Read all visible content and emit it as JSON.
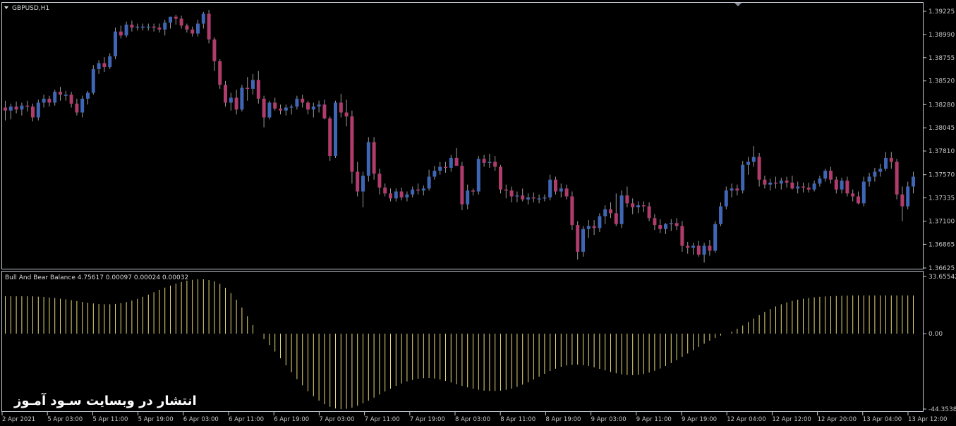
{
  "colors": {
    "background": "#000000",
    "frame": "#c4c8d0",
    "bull_candle": "#3f66b4",
    "bear_candle": "#b03c6c",
    "wick": "#9a9a9a",
    "histogram": "#e8d878",
    "axis_text": "#c8c8c8"
  },
  "main_pane": {
    "symbol_label": "GBPUSD,H1",
    "price_labels": [
      "1.39225",
      "1.38990",
      "1.38755",
      "1.38520",
      "1.38280",
      "1.38045",
      "1.37810",
      "1.37570",
      "1.37335",
      "1.37100",
      "1.36865",
      "1.36625"
    ]
  },
  "sub_pane": {
    "title": "Bull And Bear Balance 4.75617 0.00097 0.00024 0.00032",
    "value_labels": [
      "33.65542",
      "0.00",
      "-44.35384"
    ]
  },
  "time_labels": [
    "2 Apr 2021",
    "5 Apr 03:00",
    "5 Apr 11:00",
    "5 Apr 19:00",
    "6 Apr 03:00",
    "6 Apr 11:00",
    "6 Apr 19:00",
    "7 Apr 03:00",
    "7 Apr 11:00",
    "7 Apr 19:00",
    "8 Apr 03:00",
    "8 Apr 11:00",
    "8 Apr 19:00",
    "9 Apr 03:00",
    "9 Apr 11:00",
    "9 Apr 19:00",
    "12 Apr 04:00",
    "12 Apr 12:00",
    "12 Apr 20:00",
    "13 Apr 04:00",
    "13 Apr 12:00"
  ],
  "watermark": "انتشار در وبسایت سـود آمـوز",
  "chart_data": [
    {
      "type": "candlestick",
      "title": "GBPUSD,H1",
      "ylim": [
        1.36625,
        1.39225
      ],
      "ohlc": [
        [
          1.3825,
          1.3832,
          1.3812,
          1.3822
        ],
        [
          1.3822,
          1.3829,
          1.3813,
          1.3826
        ],
        [
          1.3826,
          1.3831,
          1.3819,
          1.3823
        ],
        [
          1.3823,
          1.383,
          1.3817,
          1.3827
        ],
        [
          1.3827,
          1.3832,
          1.3821,
          1.3826
        ],
        [
          1.3826,
          1.3829,
          1.3811,
          1.3815
        ],
        [
          1.3815,
          1.3833,
          1.3812,
          1.383
        ],
        [
          1.383,
          1.3838,
          1.3825,
          1.3834
        ],
        [
          1.3834,
          1.3837,
          1.3826,
          1.383
        ],
        [
          1.383,
          1.3843,
          1.3827,
          1.3841
        ],
        [
          1.3841,
          1.3846,
          1.3832,
          1.3838
        ],
        [
          1.3838,
          1.3842,
          1.3832,
          1.3838
        ],
        [
          1.3838,
          1.3841,
          1.3825,
          1.3829
        ],
        [
          1.3829,
          1.3834,
          1.3817,
          1.382
        ],
        [
          1.382,
          1.3837,
          1.3815,
          1.3834
        ],
        [
          1.3834,
          1.3842,
          1.3828,
          1.384
        ],
        [
          1.384,
          1.3868,
          1.3838,
          1.3864
        ],
        [
          1.3864,
          1.3873,
          1.3859,
          1.387
        ],
        [
          1.387,
          1.3876,
          1.3861,
          1.3866
        ],
        [
          1.3866,
          1.388,
          1.3864,
          1.3877
        ],
        [
          1.3877,
          1.3906,
          1.3874,
          1.3902
        ],
        [
          1.3902,
          1.3908,
          1.3895,
          1.3898
        ],
        [
          1.3898,
          1.3912,
          1.3896,
          1.3909
        ],
        [
          1.3909,
          1.3913,
          1.3902,
          1.3906
        ],
        [
          1.3906,
          1.391,
          1.3903,
          1.3907
        ],
        [
          1.3907,
          1.391,
          1.3903,
          1.3907
        ],
        [
          1.3907,
          1.391,
          1.3903,
          1.3907
        ],
        [
          1.3907,
          1.391,
          1.3902,
          1.3906
        ],
        [
          1.3906,
          1.391,
          1.3901,
          1.3904
        ],
        [
          1.3904,
          1.3914,
          1.3898,
          1.3911
        ],
        [
          1.3911,
          1.3917,
          1.3905,
          1.3917
        ],
        [
          1.3917,
          1.3919,
          1.3909,
          1.3915
        ],
        [
          1.3915,
          1.3918,
          1.3905,
          1.3908
        ],
        [
          1.3908,
          1.391,
          1.3901,
          1.3904
        ],
        [
          1.3904,
          1.3907,
          1.3897,
          1.39
        ],
        [
          1.39,
          1.3914,
          1.3897,
          1.391
        ],
        [
          1.391,
          1.3922,
          1.3905,
          1.392
        ],
        [
          1.392,
          1.3924,
          1.389,
          1.3894
        ],
        [
          1.3894,
          1.3896,
          1.3862,
          1.3872
        ],
        [
          1.3872,
          1.3874,
          1.3844,
          1.3848
        ],
        [
          1.3848,
          1.3852,
          1.3826,
          1.383
        ],
        [
          1.383,
          1.384,
          1.3822,
          1.3835
        ],
        [
          1.3835,
          1.3843,
          1.3818,
          1.3823
        ],
        [
          1.3823,
          1.3848,
          1.3821,
          1.3845
        ],
        [
          1.3845,
          1.3856,
          1.3832,
          1.3844
        ],
        [
          1.3844,
          1.3859,
          1.3838,
          1.3853
        ],
        [
          1.3853,
          1.3862,
          1.3829,
          1.3834
        ],
        [
          1.3834,
          1.3837,
          1.3805,
          1.3815
        ],
        [
          1.3815,
          1.3832,
          1.3813,
          1.383
        ],
        [
          1.383,
          1.3835,
          1.3822,
          1.3824
        ],
        [
          1.3824,
          1.3828,
          1.3818,
          1.3822
        ],
        [
          1.3822,
          1.3828,
          1.3817,
          1.3825
        ],
        [
          1.3825,
          1.3828,
          1.3818,
          1.3826
        ],
        [
          1.3826,
          1.3837,
          1.3823,
          1.3834
        ],
        [
          1.3834,
          1.3838,
          1.3825,
          1.383
        ],
        [
          1.383,
          1.3832,
          1.3818,
          1.3823
        ],
        [
          1.3823,
          1.383,
          1.3815,
          1.3826
        ],
        [
          1.3826,
          1.3832,
          1.382,
          1.3828
        ],
        [
          1.3828,
          1.3833,
          1.3813,
          1.3814
        ],
        [
          1.3814,
          1.3816,
          1.3771,
          1.3776
        ],
        [
          1.3776,
          1.3832,
          1.3774,
          1.383
        ],
        [
          1.383,
          1.3839,
          1.3815,
          1.382
        ],
        [
          1.382,
          1.3833,
          1.3806,
          1.3816
        ],
        [
          1.3816,
          1.3822,
          1.3748,
          1.376
        ],
        [
          1.376,
          1.377,
          1.3735,
          1.374
        ],
        [
          1.374,
          1.376,
          1.3724,
          1.3756
        ],
        [
          1.3756,
          1.3795,
          1.375,
          1.379
        ],
        [
          1.379,
          1.3795,
          1.3752,
          1.3758
        ],
        [
          1.3758,
          1.3763,
          1.3737,
          1.3744
        ],
        [
          1.3744,
          1.3748,
          1.3735,
          1.3738
        ],
        [
          1.3738,
          1.3743,
          1.373,
          1.3733
        ],
        [
          1.3733,
          1.3743,
          1.373,
          1.374
        ],
        [
          1.374,
          1.3744,
          1.3731,
          1.3734
        ],
        [
          1.3734,
          1.374,
          1.373,
          1.3737
        ],
        [
          1.3737,
          1.3745,
          1.3734,
          1.3742
        ],
        [
          1.3742,
          1.3748,
          1.3737,
          1.3741
        ],
        [
          1.3741,
          1.3746,
          1.3736,
          1.3743
        ],
        [
          1.3743,
          1.3762,
          1.3741,
          1.3755
        ],
        [
          1.3755,
          1.3766,
          1.3752,
          1.3761
        ],
        [
          1.3761,
          1.377,
          1.3757,
          1.3765
        ],
        [
          1.3765,
          1.377,
          1.3759,
          1.3764
        ],
        [
          1.3764,
          1.3777,
          1.376,
          1.3774
        ],
        [
          1.3774,
          1.3784,
          1.3768,
          1.3766
        ],
        [
          1.3766,
          1.377,
          1.3721,
          1.3727
        ],
        [
          1.3727,
          1.3747,
          1.3722,
          1.3741
        ],
        [
          1.3741,
          1.3743,
          1.3736,
          1.374
        ],
        [
          1.374,
          1.3776,
          1.3737,
          1.3773
        ],
        [
          1.3773,
          1.3777,
          1.3765,
          1.3769
        ],
        [
          1.3769,
          1.3778,
          1.3764,
          1.377
        ],
        [
          1.377,
          1.3776,
          1.3761,
          1.3765
        ],
        [
          1.3765,
          1.3767,
          1.3738,
          1.3742
        ],
        [
          1.3742,
          1.3747,
          1.3733,
          1.3741
        ],
        [
          1.3741,
          1.3745,
          1.3729,
          1.3735
        ],
        [
          1.3735,
          1.374,
          1.3729,
          1.3736
        ],
        [
          1.3736,
          1.3743,
          1.373,
          1.3732
        ],
        [
          1.3732,
          1.3738,
          1.3727,
          1.3734
        ],
        [
          1.3734,
          1.3739,
          1.3729,
          1.3733
        ],
        [
          1.3733,
          1.3737,
          1.3728,
          1.3733
        ],
        [
          1.3733,
          1.3737,
          1.373,
          1.3734
        ],
        [
          1.3734,
          1.3757,
          1.3731,
          1.3752
        ],
        [
          1.3752,
          1.3755,
          1.3737,
          1.374
        ],
        [
          1.374,
          1.3748,
          1.3734,
          1.3743
        ],
        [
          1.3743,
          1.3747,
          1.3732,
          1.3735
        ],
        [
          1.3735,
          1.374,
          1.3701,
          1.3706
        ],
        [
          1.3706,
          1.371,
          1.3671,
          1.3679
        ],
        [
          1.3679,
          1.3705,
          1.3674,
          1.3702
        ],
        [
          1.3702,
          1.3711,
          1.3693,
          1.3705
        ],
        [
          1.3705,
          1.3711,
          1.3696,
          1.3703
        ],
        [
          1.3703,
          1.3718,
          1.3699,
          1.3715
        ],
        [
          1.3715,
          1.3726,
          1.3707,
          1.3722
        ],
        [
          1.3722,
          1.3729,
          1.3713,
          1.3718
        ],
        [
          1.3718,
          1.3738,
          1.3705,
          1.3707
        ],
        [
          1.3707,
          1.3741,
          1.3703,
          1.3736
        ],
        [
          1.3736,
          1.3745,
          1.3724,
          1.3728
        ],
        [
          1.3728,
          1.3733,
          1.3717,
          1.3724
        ],
        [
          1.3724,
          1.373,
          1.3718,
          1.3726
        ],
        [
          1.3726,
          1.373,
          1.3719,
          1.3725
        ],
        [
          1.3725,
          1.3729,
          1.371,
          1.3713
        ],
        [
          1.3713,
          1.3717,
          1.3701,
          1.3706
        ],
        [
          1.3706,
          1.3712,
          1.3698,
          1.3702
        ],
        [
          1.3702,
          1.3708,
          1.3697,
          1.3707
        ],
        [
          1.3707,
          1.3712,
          1.37,
          1.3708
        ],
        [
          1.3708,
          1.3713,
          1.3701,
          1.3705
        ],
        [
          1.3705,
          1.371,
          1.3679,
          1.3685
        ],
        [
          1.3685,
          1.3689,
          1.3677,
          1.3683
        ],
        [
          1.3683,
          1.3688,
          1.3676,
          1.3685
        ],
        [
          1.3685,
          1.369,
          1.3674,
          1.3676
        ],
        [
          1.3676,
          1.3688,
          1.3668,
          1.3685
        ],
        [
          1.3685,
          1.3691,
          1.3675,
          1.368
        ],
        [
          1.368,
          1.371,
          1.3678,
          1.3707
        ],
        [
          1.3707,
          1.3729,
          1.3705,
          1.3725
        ],
        [
          1.3725,
          1.3745,
          1.3722,
          1.3741
        ],
        [
          1.3741,
          1.3748,
          1.3734,
          1.3743
        ],
        [
          1.3743,
          1.3747,
          1.3736,
          1.3741
        ],
        [
          1.3741,
          1.3771,
          1.3738,
          1.3767
        ],
        [
          1.3767,
          1.3775,
          1.3757,
          1.377
        ],
        [
          1.377,
          1.3786,
          1.3765,
          1.3775
        ],
        [
          1.3775,
          1.3779,
          1.3745,
          1.3752
        ],
        [
          1.3752,
          1.3756,
          1.3743,
          1.3747
        ],
        [
          1.3747,
          1.3753,
          1.3741,
          1.3749
        ],
        [
          1.3749,
          1.3755,
          1.3743,
          1.3748
        ],
        [
          1.3748,
          1.3754,
          1.3742,
          1.3751
        ],
        [
          1.3751,
          1.3755,
          1.3744,
          1.3749
        ],
        [
          1.3749,
          1.3756,
          1.3742,
          1.3743
        ],
        [
          1.3743,
          1.375,
          1.3738,
          1.3745
        ],
        [
          1.3745,
          1.3749,
          1.3739,
          1.3744
        ],
        [
          1.3744,
          1.3749,
          1.3739,
          1.3742
        ],
        [
          1.3742,
          1.3751,
          1.374,
          1.3748
        ],
        [
          1.3748,
          1.3756,
          1.3745,
          1.3753
        ],
        [
          1.3753,
          1.3763,
          1.375,
          1.3761
        ],
        [
          1.3761,
          1.3765,
          1.3748,
          1.3752
        ],
        [
          1.3752,
          1.3755,
          1.3738,
          1.3742
        ],
        [
          1.3742,
          1.3754,
          1.3738,
          1.3751
        ],
        [
          1.3751,
          1.3755,
          1.3735,
          1.3738
        ],
        [
          1.3738,
          1.3742,
          1.373,
          1.3735
        ],
        [
          1.3735,
          1.374,
          1.3727,
          1.3728
        ],
        [
          1.3728,
          1.3755,
          1.3725,
          1.375
        ],
        [
          1.375,
          1.3759,
          1.3745,
          1.3755
        ],
        [
          1.3755,
          1.3764,
          1.375,
          1.376
        ],
        [
          1.376,
          1.3768,
          1.3755,
          1.3763
        ],
        [
          1.3763,
          1.378,
          1.3761,
          1.3774
        ],
        [
          1.3774,
          1.378,
          1.3763,
          1.377
        ],
        [
          1.377,
          1.3773,
          1.3732,
          1.3737
        ],
        [
          1.3737,
          1.3745,
          1.371,
          1.3725
        ],
        [
          1.3725,
          1.375,
          1.3722,
          1.3745
        ],
        [
          1.3745,
          1.376,
          1.3738,
          1.3755
        ]
      ]
    },
    {
      "type": "bar",
      "title": "Bull And Bear Balance 4.75617 0.00097 0.00024 0.00032",
      "ylim": [
        -44.35384,
        33.65542
      ],
      "values": [
        22.0,
        22.0,
        22.0,
        22.0,
        22.0,
        22.0,
        21.8,
        21.6,
        21.3,
        21.0,
        20.6,
        20.2,
        19.7,
        19.2,
        18.7,
        18.2,
        17.8,
        17.5,
        17.3,
        17.3,
        17.5,
        18.0,
        18.6,
        19.5,
        20.5,
        21.7,
        23.0,
        24.4,
        25.8,
        27.1,
        28.3,
        29.4,
        30.4,
        31.2,
        31.7,
        32.0,
        32.0,
        31.6,
        30.8,
        29.3,
        27.0,
        23.9,
        20.0,
        15.4,
        10.3,
        5.0,
        0.0,
        -3.2,
        -6.7,
        -10.5,
        -14.5,
        -18.6,
        -22.7,
        -26.7,
        -30.4,
        -33.8,
        -36.8,
        -39.4,
        -41.5,
        -43.0,
        -44.0,
        -44.4,
        -44.2,
        -43.5,
        -42.4,
        -41.0,
        -39.4,
        -37.6,
        -35.8,
        -34.0,
        -32.3,
        -30.7,
        -29.3,
        -28.1,
        -27.2,
        -26.5,
        -26.2,
        -26.1,
        -26.4,
        -27.0,
        -27.8,
        -28.7,
        -29.7,
        -30.7,
        -31.6,
        -32.4,
        -33.0,
        -33.5,
        -33.7,
        -33.7,
        -33.5,
        -33.0,
        -32.3,
        -31.3,
        -30.0,
        -28.6,
        -27.0,
        -25.3,
        -23.6,
        -22.0,
        -20.6,
        -19.5,
        -18.7,
        -18.3,
        -18.2,
        -18.5,
        -19.0,
        -19.8,
        -20.7,
        -21.6,
        -22.5,
        -23.3,
        -23.9,
        -24.3,
        -24.4,
        -24.2,
        -23.7,
        -22.9,
        -21.8,
        -20.5,
        -19.0,
        -17.3,
        -15.5,
        -13.6,
        -11.7,
        -9.7,
        -7.8,
        -5.9,
        -4.1,
        -2.5,
        -1.1,
        0.0,
        1.2,
        2.9,
        4.8,
        6.8,
        8.9,
        10.9,
        12.8,
        14.5,
        16.0,
        17.3,
        18.4,
        19.3,
        20.0,
        20.6,
        21.0,
        21.4,
        21.7,
        21.9,
        22.1,
        22.2,
        22.3,
        22.4,
        22.5,
        22.5,
        22.5,
        22.5,
        22.5,
        22.5,
        22.5,
        22.5,
        22.5,
        22.5,
        22.5,
        22.5
      ]
    }
  ]
}
